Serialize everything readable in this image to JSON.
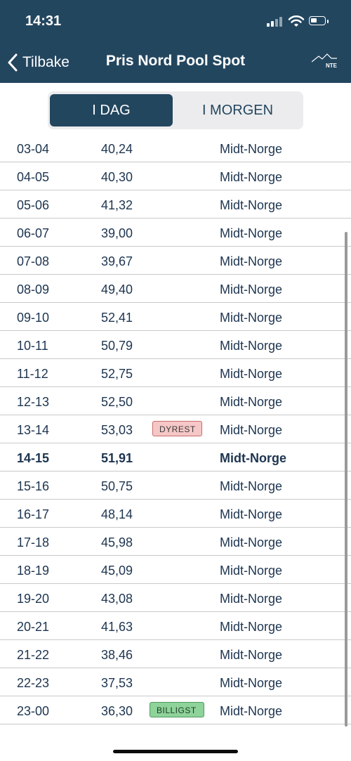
{
  "status_bar": {
    "time": "14:31",
    "icons": [
      "signal-icon",
      "wifi-icon",
      "battery-icon"
    ]
  },
  "nav": {
    "back_label": "Tilbake",
    "title": "Pris Nord Pool Spot",
    "logo_text": "NTE"
  },
  "tabs": [
    {
      "label": "I DAG",
      "active": true
    },
    {
      "label": "I MORGEN",
      "active": false
    }
  ],
  "rows": [
    {
      "hour": "03-04",
      "price": "40,24",
      "area": "Midt-Norge",
      "badge": ""
    },
    {
      "hour": "04-05",
      "price": "40,30",
      "area": "Midt-Norge",
      "badge": ""
    },
    {
      "hour": "05-06",
      "price": "41,32",
      "area": "Midt-Norge",
      "badge": ""
    },
    {
      "hour": "06-07",
      "price": "39,00",
      "area": "Midt-Norge",
      "badge": ""
    },
    {
      "hour": "07-08",
      "price": "39,67",
      "area": "Midt-Norge",
      "badge": ""
    },
    {
      "hour": "08-09",
      "price": "49,40",
      "area": "Midt-Norge",
      "badge": ""
    },
    {
      "hour": "09-10",
      "price": "52,41",
      "area": "Midt-Norge",
      "badge": ""
    },
    {
      "hour": "10-11",
      "price": "50,79",
      "area": "Midt-Norge",
      "badge": ""
    },
    {
      "hour": "11-12",
      "price": "52,75",
      "area": "Midt-Norge",
      "badge": ""
    },
    {
      "hour": "12-13",
      "price": "52,50",
      "area": "Midt-Norge",
      "badge": ""
    },
    {
      "hour": "13-14",
      "price": "53,03",
      "area": "Midt-Norge",
      "badge": "DYREST"
    },
    {
      "hour": "14-15",
      "price": "51,91",
      "area": "Midt-Norge",
      "badge": "",
      "current": true
    },
    {
      "hour": "15-16",
      "price": "50,75",
      "area": "Midt-Norge",
      "badge": ""
    },
    {
      "hour": "16-17",
      "price": "48,14",
      "area": "Midt-Norge",
      "badge": ""
    },
    {
      "hour": "17-18",
      "price": "45,98",
      "area": "Midt-Norge",
      "badge": ""
    },
    {
      "hour": "18-19",
      "price": "45,09",
      "area": "Midt-Norge",
      "badge": ""
    },
    {
      "hour": "19-20",
      "price": "43,08",
      "area": "Midt-Norge",
      "badge": ""
    },
    {
      "hour": "20-21",
      "price": "41,63",
      "area": "Midt-Norge",
      "badge": ""
    },
    {
      "hour": "21-22",
      "price": "38,46",
      "area": "Midt-Norge",
      "badge": ""
    },
    {
      "hour": "22-23",
      "price": "37,53",
      "area": "Midt-Norge",
      "badge": ""
    },
    {
      "hour": "23-00",
      "price": "36,30",
      "area": "Midt-Norge",
      "badge": "BILLIGST"
    }
  ],
  "colors": {
    "header": "#23465f",
    "text": "#1d3550",
    "dyrest": "#f6c7c7",
    "billigst": "#8ed39a"
  }
}
